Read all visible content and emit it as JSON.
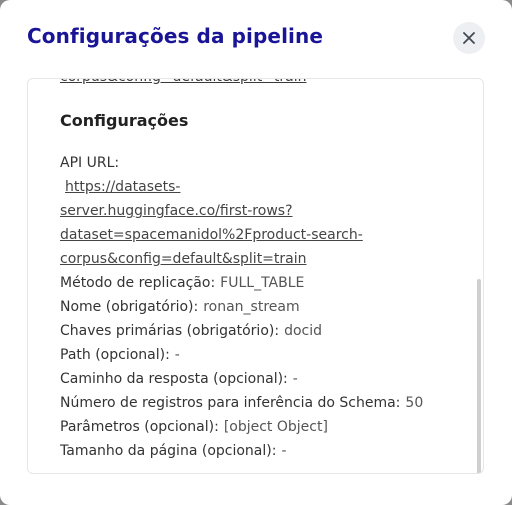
{
  "modal": {
    "title": "Configurações da pipeline",
    "close_icon": "close-icon"
  },
  "content": {
    "prev_line": "corpus&config=default&split=train",
    "section_title": "Configurações",
    "api_url": {
      "label": "API URL:",
      "lines": [
        "https://datasets-",
        "server.huggingface.co/first-rows?",
        "dataset=spacemanidol%2Fproduct-search-",
        "corpus&config=default&split=train"
      ]
    },
    "fields": [
      {
        "label": "Método de replicação:",
        "value": "FULL_TABLE"
      },
      {
        "label": "Nome (obrigatório):",
        "value": "ronan_stream"
      },
      {
        "label": "Chaves primárias (obrigatório):",
        "value": "docid"
      },
      {
        "label": "Path (opcional):",
        "value": "-"
      },
      {
        "label": "Caminho da resposta (opcional):",
        "value": "-"
      },
      {
        "label": "Número de registros para inferência do Schema:",
        "value": "50"
      },
      {
        "label": "Parâmetros (opcional):",
        "value": "[object Object]"
      },
      {
        "label": "Tamanho da página (opcional):",
        "value": "-"
      }
    ]
  }
}
